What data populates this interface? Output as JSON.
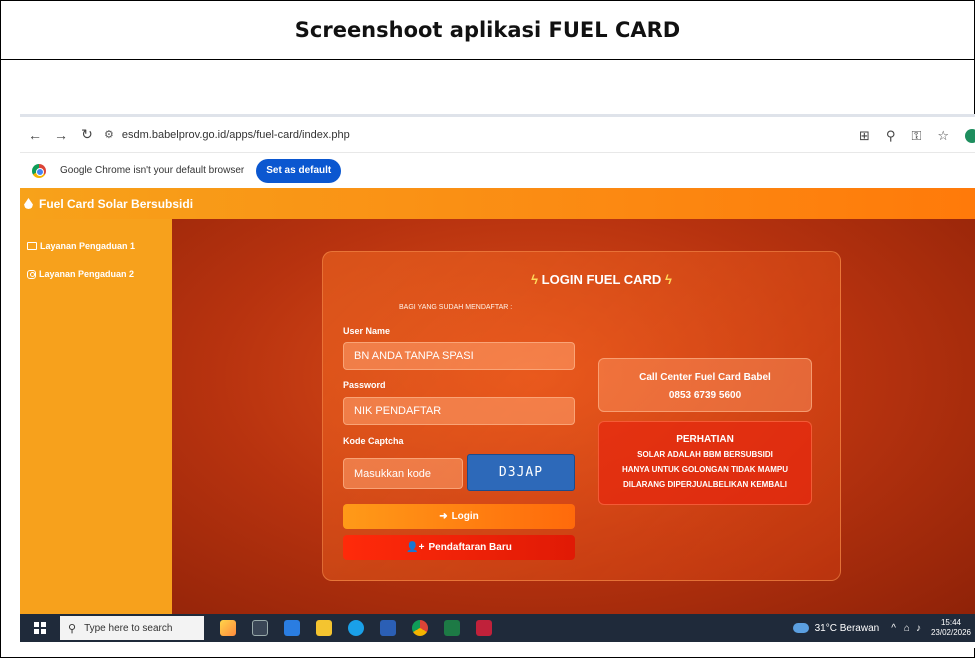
{
  "document": {
    "title": "Screenshoot aplikasi FUEL CARD"
  },
  "browser": {
    "url": "esdm.babelprov.go.id/apps/fuel-card/index.php",
    "back_icon": "arrow-left-icon",
    "forward_icon": "arrow-right-icon",
    "reload_icon": "reload-icon"
  },
  "infobar": {
    "text": "Google Chrome isn't your default browser",
    "button_label": "Set as default"
  },
  "app": {
    "title": "Fuel Card Solar Bersubsidi",
    "header_color": "#fb8c13",
    "sidebar": {
      "items": [
        {
          "label": "Layanan Pengaduan 1",
          "icon": "monitor-icon"
        },
        {
          "label": "Layanan Pengaduan 2",
          "icon": "instagram-icon"
        }
      ]
    },
    "login": {
      "title": "LOGIN FUEL CARD",
      "subtitle": "BAGI YANG SUDAH MENDAFTAR :",
      "username_label": "User Name",
      "username_placeholder": "BN ANDA TANPA SPASI",
      "password_label": "Password",
      "password_placeholder": "NIK PENDAFTAR",
      "captcha_label": "Kode Captcha",
      "captcha_placeholder": "Masukkan kode",
      "captcha_code": "D3JAP",
      "login_button": "Login",
      "register_button": "Pendaftaran Baru"
    },
    "call_center": {
      "title": "Call Center Fuel Card Babel",
      "phone": "0853 6739 5600"
    },
    "warning": {
      "title": "PERHATIAN",
      "line1": "SOLAR ADALAH BBM BERSUBSIDI",
      "line2": "HANYA UNTUK GOLONGAN TIDAK MAMPU",
      "line3": "DILARANG DIPERJUALBELIKAN KEMBALI"
    }
  },
  "taskbar": {
    "search_placeholder": "Type here to search",
    "weather": "31°C  Berawan",
    "time": "15:44",
    "date": "23/02/2026"
  }
}
